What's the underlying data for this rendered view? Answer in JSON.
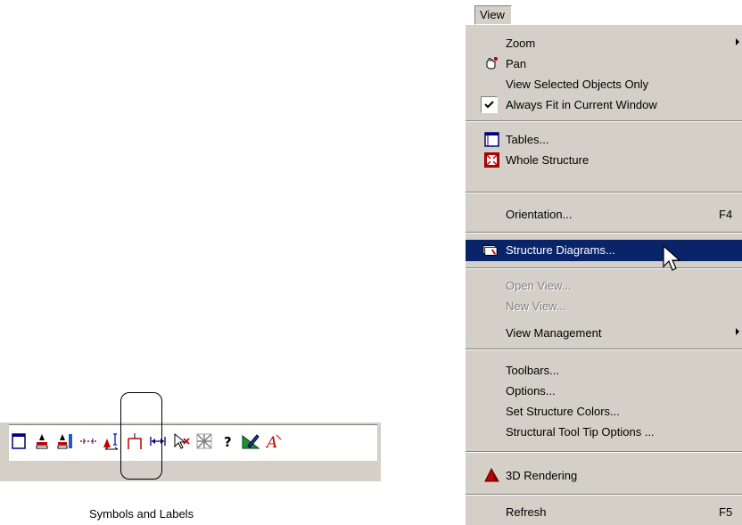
{
  "menu": {
    "title": "View",
    "items": [
      {
        "label": "Zoom",
        "submenu": true
      },
      {
        "label": "Pan",
        "icon": "pan-hand-icon"
      },
      {
        "label": "View Selected Objects Only"
      },
      {
        "label": "Always Fit in Current Window",
        "checked": true
      },
      {
        "label": "Tables...",
        "icon": "table-icon"
      },
      {
        "label": "Whole Structure",
        "icon": "whole-structure-icon"
      },
      {
        "label": "Orientation...",
        "shortcut": "F4"
      },
      {
        "label": "Structure Diagrams...",
        "icon": "structure-diagram-icon",
        "highlighted": true
      },
      {
        "label": "Open View...",
        "disabled": true
      },
      {
        "label": "New View...",
        "disabled": true
      },
      {
        "label": "View Management",
        "submenu": true
      },
      {
        "label": "Toolbars..."
      },
      {
        "label": "Options..."
      },
      {
        "label": "Set Structure Colors..."
      },
      {
        "label": "Structural Tool Tip Options ..."
      },
      {
        "label": "3D Rendering",
        "icon": "3d-rendering-icon"
      },
      {
        "label": "Refresh",
        "shortcut": "F5"
      }
    ]
  },
  "toolbar": {
    "caption": "Symbols and Labels",
    "buttons": [
      "window-icon",
      "node-labels-icon",
      "member-labels-icon",
      "dimension-icon",
      "symbols-labels-icon",
      "support-icon",
      "dimension-arrow-icon",
      "select-cursor-icon",
      "mesh-icon",
      "help-icon",
      "draw-icon",
      "font-icon"
    ]
  },
  "colors": {
    "menu_bg": "#d4d0c8",
    "highlight": "#0a246a"
  }
}
